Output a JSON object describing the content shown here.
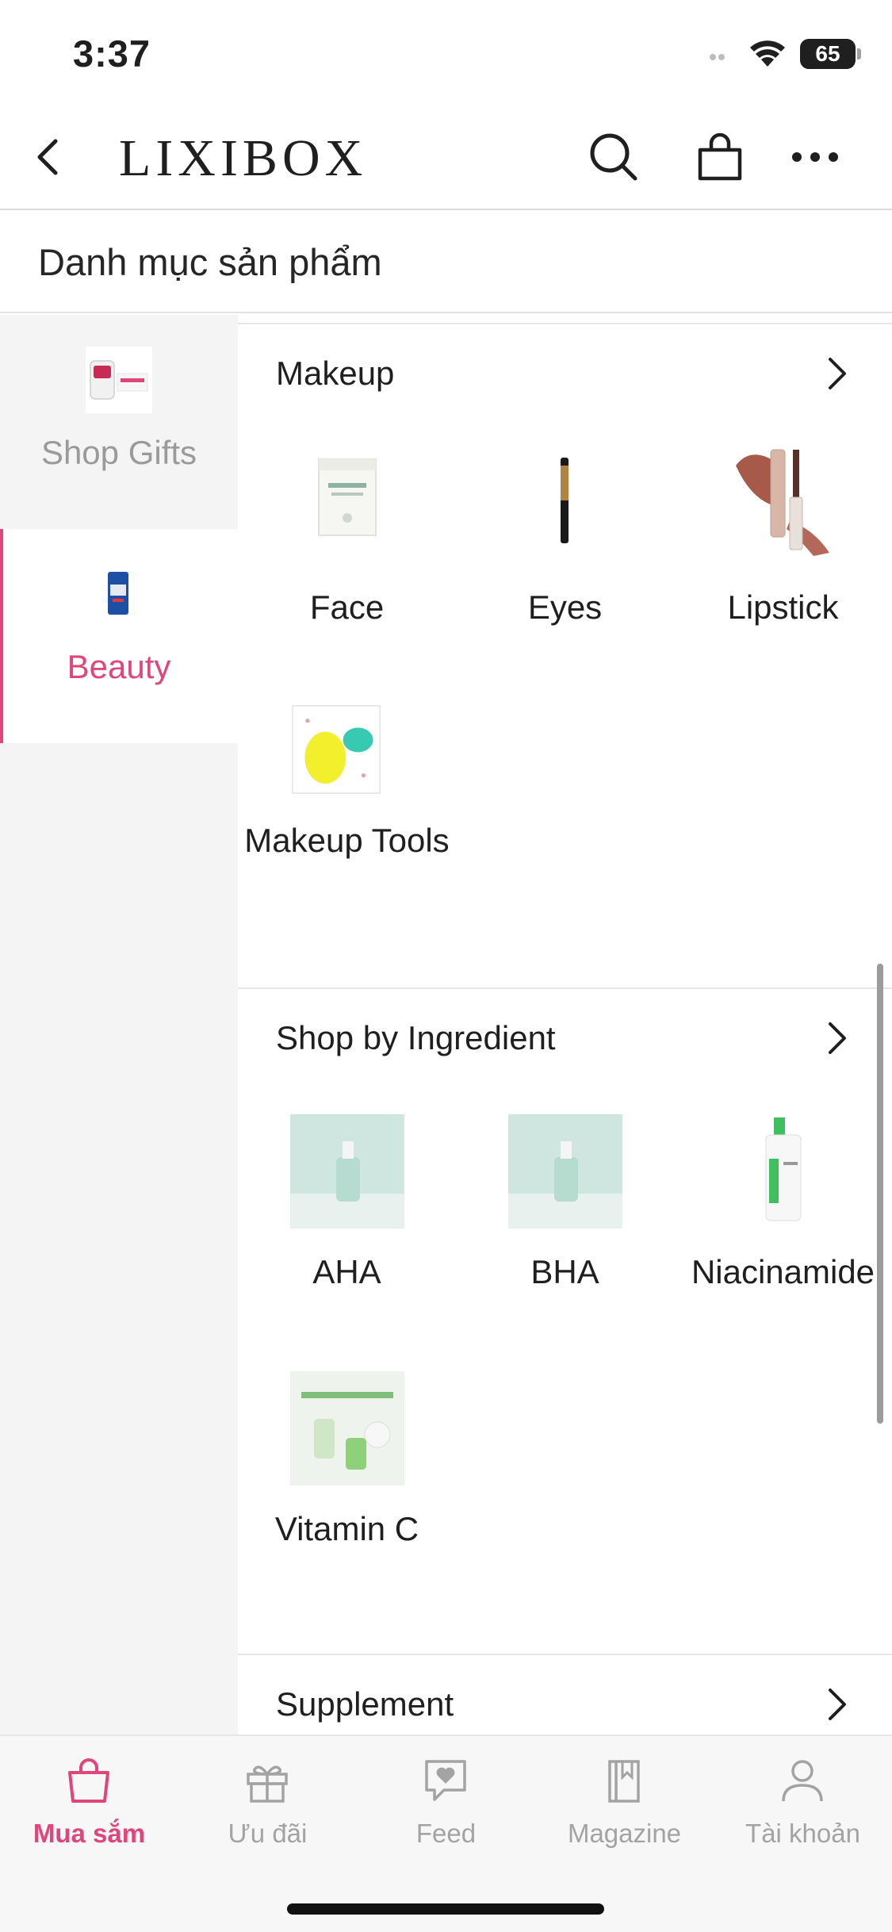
{
  "status_bar": {
    "time": "3:37",
    "battery": "65"
  },
  "nav": {
    "brand": "LIXIBOX",
    "back_icon": "chevron-left-icon",
    "search_icon": "search-icon",
    "bag_icon": "shopping-bag-icon",
    "more_icon": "more-dots-icon"
  },
  "page_title": "Danh mục sản phẩm",
  "sidebar": {
    "items": [
      {
        "label": "Shop Gifts",
        "active": false
      },
      {
        "label": "Beauty",
        "active": true
      }
    ]
  },
  "categories": [
    {
      "title": "Makeup",
      "items": [
        {
          "label": "Face"
        },
        {
          "label": "Eyes"
        },
        {
          "label": "Lipstick"
        },
        {
          "label": "Makeup Tools"
        }
      ]
    },
    {
      "title": "Shop by Ingredient",
      "items": [
        {
          "label": "AHA"
        },
        {
          "label": "BHA"
        },
        {
          "label": "Niacinamide"
        },
        {
          "label": "Vitamin C"
        }
      ]
    },
    {
      "title": "Supplement",
      "items": []
    }
  ],
  "tab_bar": {
    "tabs": [
      {
        "label": "Mua sắm",
        "icon": "shopping-bag-icon",
        "active": true
      },
      {
        "label": "Ưu đãi",
        "icon": "gift-icon",
        "active": false
      },
      {
        "label": "Feed",
        "icon": "chat-heart-icon",
        "active": false
      },
      {
        "label": "Magazine",
        "icon": "book-icon",
        "active": false
      },
      {
        "label": "Tài khoản",
        "icon": "user-icon",
        "active": false
      }
    ]
  },
  "colors": {
    "accent": "#e0457b",
    "inactive": "#a3a3a3",
    "sidebar_bg": "#f4f4f4"
  }
}
